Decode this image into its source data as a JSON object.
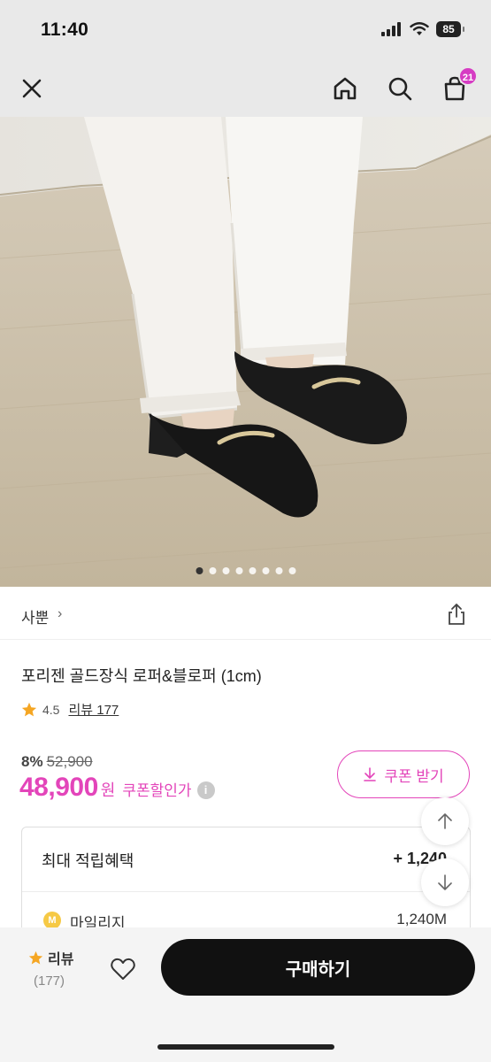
{
  "status_bar": {
    "time": "11:40",
    "battery": "85"
  },
  "nav": {
    "cart_count": "21"
  },
  "hero": {
    "dot_count": 8,
    "active_dot": 0
  },
  "brand": {
    "name": "사뿐",
    "chevron": "›"
  },
  "product": {
    "title": "포리젠 골드장식 로퍼&블로퍼 (1cm)",
    "rating": "4.5",
    "review_link": "리뷰 177"
  },
  "pricing": {
    "discount": "8%",
    "original": "52,900",
    "price": "48,900",
    "currency": "원",
    "coupon_price_label": "쿠폰할인가",
    "info_icon": "i"
  },
  "coupon_button": {
    "label": "쿠폰 받기"
  },
  "benefits": {
    "title": "최대 적립혜택",
    "total": "+ 1,240",
    "mileage_icon": "M",
    "mileage_label": "마일리지",
    "mileage_value": "1,240M"
  },
  "bottom_bar": {
    "review_label": "리뷰",
    "review_count": "(177)",
    "buy_label": "구매하기"
  },
  "colors": {
    "accent": "#e345ba",
    "star": "#f5a623"
  }
}
